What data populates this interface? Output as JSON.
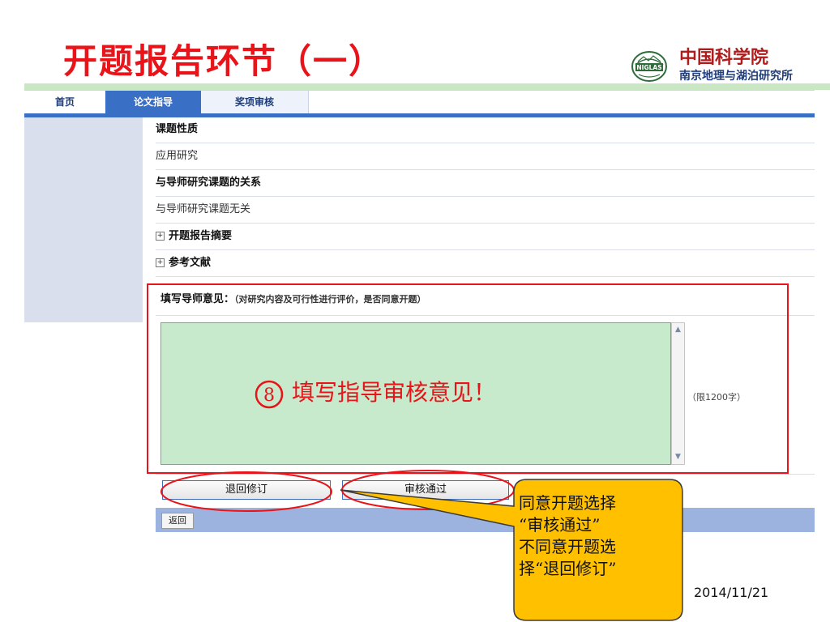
{
  "slide": {
    "title": "开题报告环节（一）",
    "date": "2014/11/21"
  },
  "logo": {
    "emblem_text": "NIGLAS",
    "line1": "中国科学院",
    "line2": "南京地理与湖泊研究所"
  },
  "nav": {
    "tabs": [
      {
        "label": "首页"
      },
      {
        "label": "论文指导"
      },
      {
        "label": "奖项审核"
      }
    ]
  },
  "rows": {
    "topic_nature_label": "课题性质",
    "topic_nature_value": "应用研究",
    "relation_label": "与导师研究课题的关系",
    "relation_value": "与导师研究课题无关",
    "abstract_label": "开题报告摘要",
    "references_label": "参考文献",
    "expand_symbol": "+"
  },
  "comment": {
    "label": "填写导师意见：",
    "hint": "（对研究内容及可行性进行评价，是否同意开题）",
    "limit": "（限1200字）",
    "annotation_number": "8",
    "annotation_text": "填写指导审核意见！"
  },
  "buttons": {
    "reject": "退回修订",
    "approve": "审核通过",
    "back": "返回"
  },
  "callout": {
    "line1": "同意开题选择",
    "line2": "“审核通过”",
    "line3": "不同意开题选",
    "line4": "择“退回修订”"
  },
  "colors": {
    "accent_red": "#e8141a",
    "nav_blue": "#3a6fc6",
    "textarea_green": "#c8eacc",
    "callout_yellow": "#ffc000"
  },
  "icons": {
    "scroll_up": "scroll-up-arrow-icon",
    "scroll_down": "scroll-down-arrow-icon",
    "expand": "plus-box-icon"
  }
}
